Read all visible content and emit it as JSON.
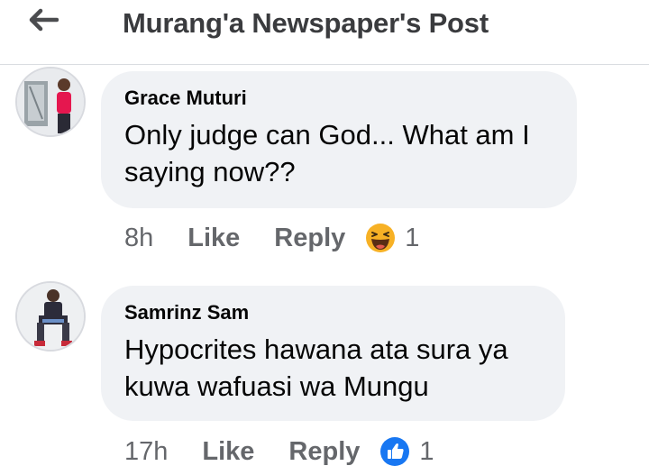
{
  "header": {
    "title": "Murang'a Newspaper's Post"
  },
  "comments": [
    {
      "author": "Grace Muturi",
      "text_line1": "Only judge can God... What am I",
      "text_line2": "saying now??",
      "time": "8h",
      "like_label": "Like",
      "reply_label": "Reply",
      "reaction_icon": "laughing-emoji-icon",
      "reaction_count": "1"
    },
    {
      "author": "Samrinz Sam",
      "text_line1": "Hypocrites hawana ata sura ya",
      "text_line2": "kuwa wafuasi wa Mungu",
      "time": "17h",
      "like_label": "Like",
      "reply_label": "Reply",
      "reaction_icon": "thumbs-up-icon",
      "reaction_count": "1"
    }
  ],
  "colors": {
    "bubble": "#f0f2f5",
    "meta_text": "#65676b",
    "like_blue": "#1877f2",
    "haha_yellow": "#f7b125"
  }
}
